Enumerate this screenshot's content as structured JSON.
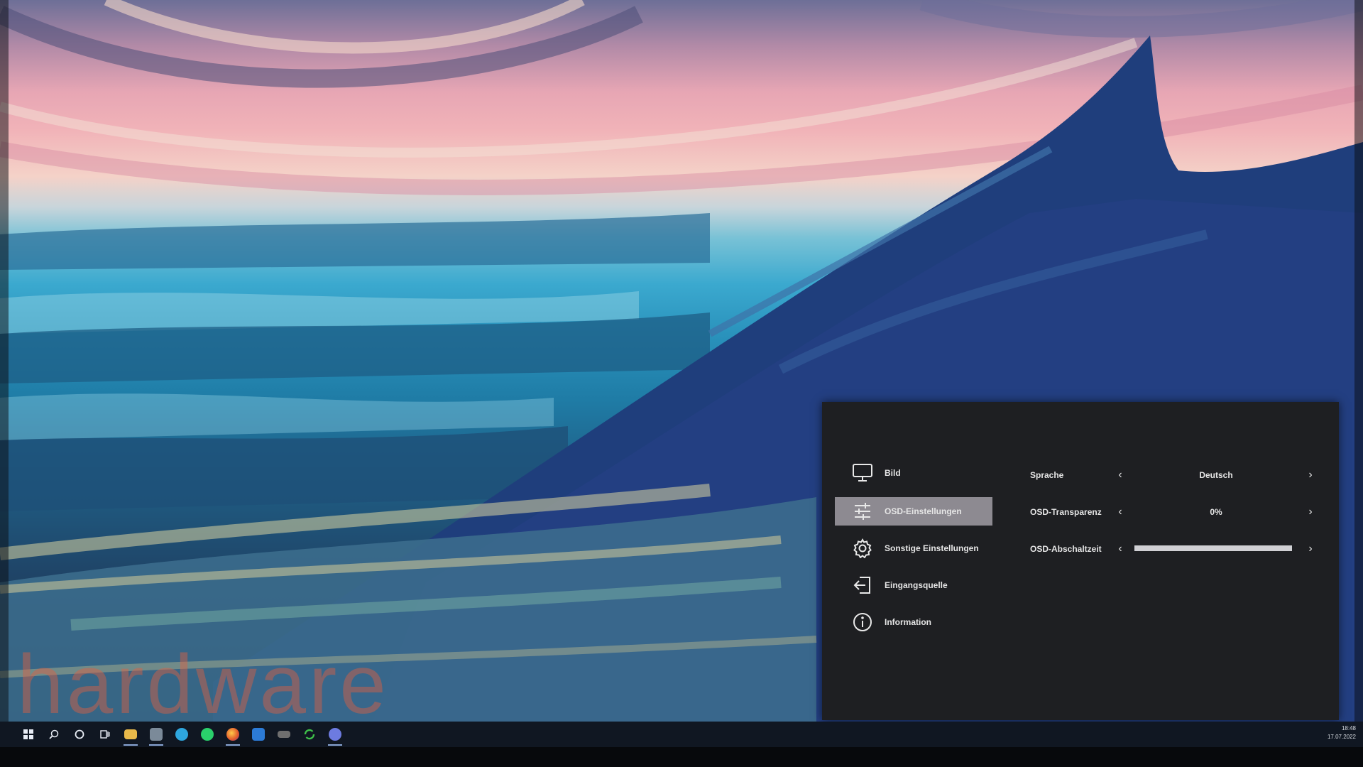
{
  "osd": {
    "menu": [
      {
        "icon": "monitor-icon",
        "label": "Bild"
      },
      {
        "icon": "sliders-icon",
        "label": "OSD-Einstellungen",
        "active": true
      },
      {
        "icon": "gear-icon",
        "label": "Sonstige Einstellungen"
      },
      {
        "icon": "input-source-icon",
        "label": "Eingangsquelle"
      },
      {
        "icon": "info-icon",
        "label": "Information"
      }
    ],
    "settings": [
      {
        "label": "Sprache",
        "value": "Deutsch"
      },
      {
        "label": "OSD-Transparenz",
        "value": "0%"
      },
      {
        "label": "OSD-Abschaltzeit",
        "slider_level": 1.0
      }
    ],
    "active_color": "#8d8a91"
  },
  "watermark": {
    "text": "hardware"
  },
  "taskbar": {
    "apps": [
      "start-icon",
      "search-icon",
      "cortana-icon",
      "task-view-icon",
      "file-explorer-icon",
      "app-icon",
      "telegram-icon",
      "whatsapp-icon",
      "firefox-icon",
      "mail-icon",
      "app-icon",
      "sync-icon",
      "discord-icon"
    ],
    "clock": {
      "time": "18:48",
      "date": "17.07.2022"
    }
  }
}
